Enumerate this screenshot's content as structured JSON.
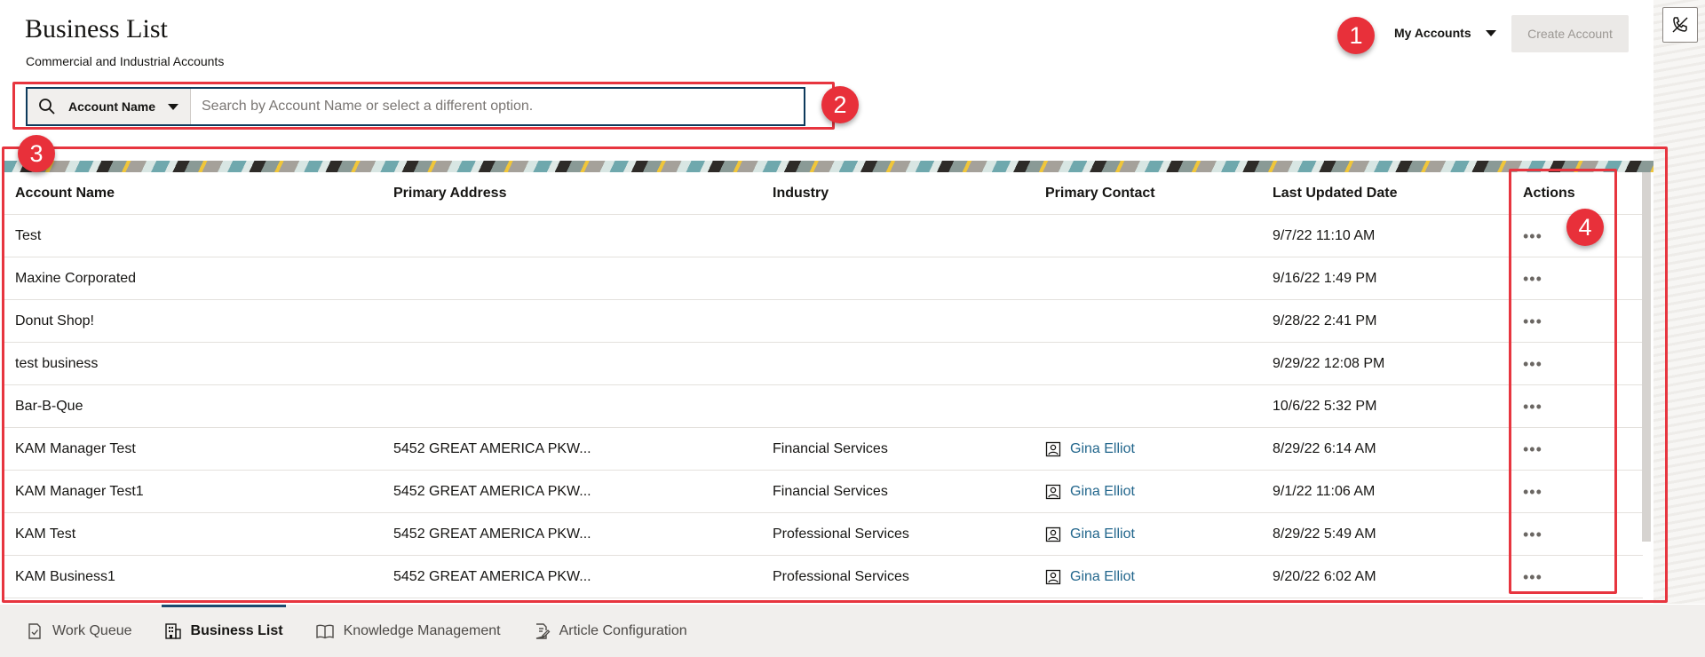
{
  "header": {
    "title": "Business List",
    "subtitle": "Commercial and Industrial Accounts",
    "filter_label": "My Accounts",
    "create_button": "Create Account"
  },
  "search": {
    "field_label": "Account Name",
    "placeholder": "Search by Account Name or select a different option."
  },
  "callouts": [
    "1",
    "2",
    "3",
    "4"
  ],
  "table": {
    "columns": [
      "Account Name",
      "Primary Address",
      "Industry",
      "Primary Contact",
      "Last Updated Date",
      "Actions"
    ],
    "rows": [
      {
        "name": "Test",
        "address": "",
        "industry": "",
        "contact": "",
        "updated": "9/7/22 11:10 AM"
      },
      {
        "name": "Maxine Corporated",
        "address": "",
        "industry": "",
        "contact": "",
        "updated": "9/16/22 1:49 PM"
      },
      {
        "name": "Donut Shop!",
        "address": "",
        "industry": "",
        "contact": "",
        "updated": "9/28/22 2:41 PM"
      },
      {
        "name": "test business",
        "address": "",
        "industry": "",
        "contact": "",
        "updated": "9/29/22 12:08 PM"
      },
      {
        "name": "Bar-B-Que",
        "address": "",
        "industry": "",
        "contact": "",
        "updated": "10/6/22 5:32 PM"
      },
      {
        "name": "KAM Manager Test",
        "address": "5452 GREAT AMERICA PKW...",
        "industry": "Financial Services",
        "contact": "Gina Elliot",
        "updated": "8/29/22 6:14 AM"
      },
      {
        "name": "KAM Manager Test1",
        "address": "5452 GREAT AMERICA PKW...",
        "industry": "Financial Services",
        "contact": "Gina Elliot",
        "updated": "9/1/22 11:06 AM"
      },
      {
        "name": "KAM Test",
        "address": "5452 GREAT AMERICA PKW...",
        "industry": "Professional Services",
        "contact": "Gina Elliot",
        "updated": "8/29/22 5:49 AM"
      },
      {
        "name": "KAM Business1",
        "address": "5452 GREAT AMERICA PKW...",
        "industry": "Professional Services",
        "contact": "Gina Elliot",
        "updated": "9/20/22 6:02 AM"
      }
    ],
    "actions_glyph": "•••"
  },
  "bottom_nav": [
    {
      "label": "Work Queue",
      "icon": "work-queue-icon",
      "active": false
    },
    {
      "label": "Business List",
      "icon": "building-icon",
      "active": true
    },
    {
      "label": "Knowledge Management",
      "icon": "book-icon",
      "active": false
    },
    {
      "label": "Article Configuration",
      "icon": "article-config-icon",
      "active": false
    }
  ],
  "colors": {
    "highlight": "#e7353f",
    "link": "#22668c",
    "nav_active": "#1c4a6e"
  }
}
